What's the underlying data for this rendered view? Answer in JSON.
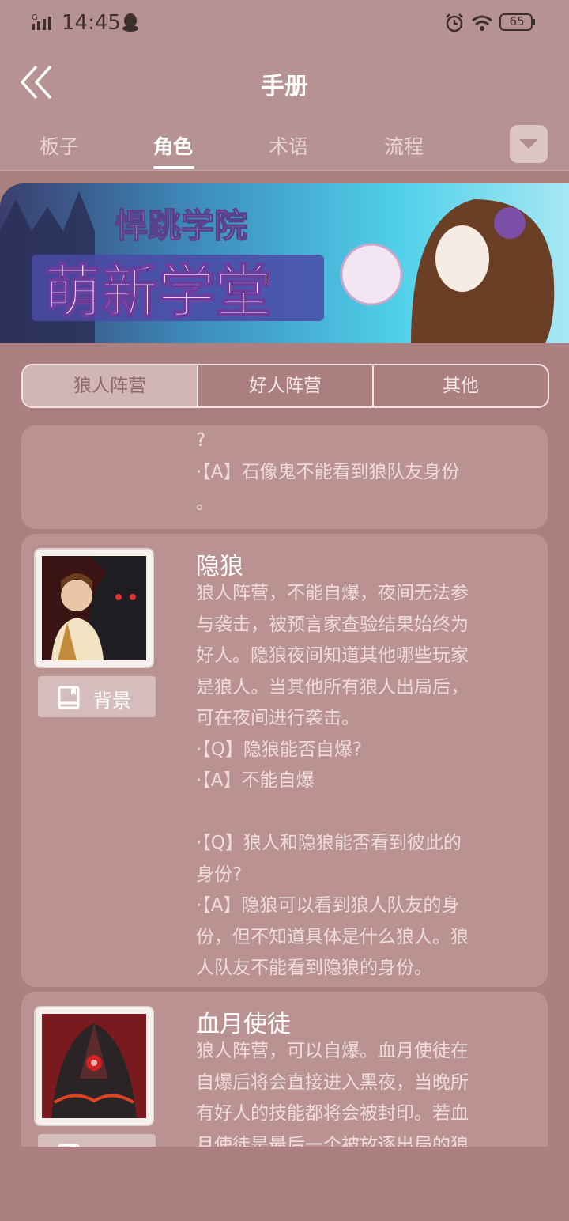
{
  "status_bar": {
    "time": "14:45",
    "battery": "65"
  },
  "header": {
    "title": "手册"
  },
  "tabs": [
    {
      "label": "板子"
    },
    {
      "label": "角色"
    },
    {
      "label": "术语"
    },
    {
      "label": "流程"
    }
  ],
  "active_tab": "角色",
  "banner": {
    "subtitle": "悍跳学院",
    "title": "萌新学堂"
  },
  "camps": [
    {
      "label": "狼人阵营"
    },
    {
      "label": "好人阵营"
    },
    {
      "label": "其他"
    }
  ],
  "active_camp": "狼人阵营",
  "cards": [
    {
      "lines": [
        "?",
        "·【A】石像鬼不能看到狼队友身份",
        "。"
      ]
    },
    {
      "name": "隐狼",
      "button": "背景",
      "lines": [
        "狼人阵营，不能自爆，夜间无法参",
        "与袭击，被预言家查验结果始终为",
        "好人。隐狼夜间知道其他哪些玩家",
        "是狼人。当其他所有狼人出局后，",
        "可在夜间进行袭击。",
        "·【Q】隐狼能否自爆?",
        "·【A】不能自爆",
        "",
        "·【Q】狼人和隐狼能否看到彼此的",
        "身份?",
        "·【A】隐狼可以看到狼人队友的身",
        "份，但不知道具体是什么狼人。狼",
        "人队友不能看到隐狼的身份。"
      ]
    },
    {
      "name": "血月使徒",
      "button": "背景",
      "lines": [
        "狼人阵营，可以自爆。血月使徒在",
        "自爆后将会直接进入黑夜，当晚所",
        "有好人的技能都将会被封印。若血",
        "月使徒是最后一个被放逐出局的狼"
      ]
    }
  ]
}
